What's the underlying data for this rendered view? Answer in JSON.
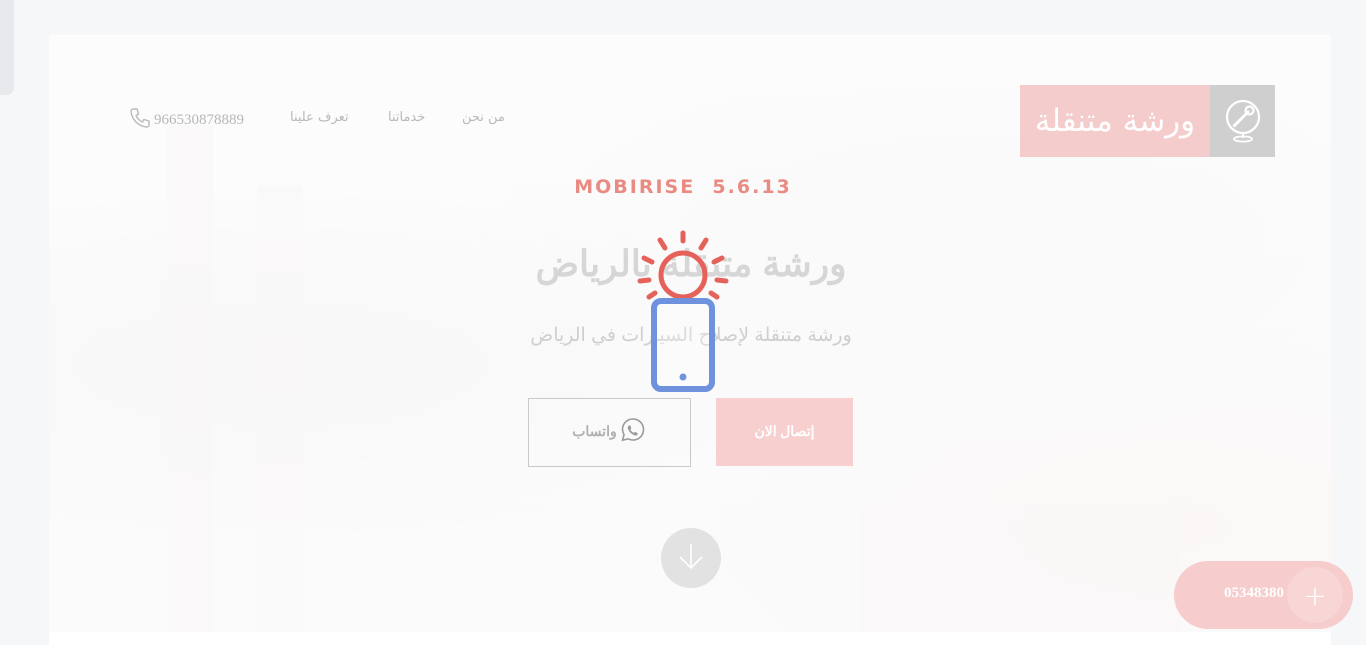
{
  "nav": {
    "logo_text": "ورشة متنقلة",
    "items": [
      "من نحن",
      "خدماتنا",
      "تعرف علينا"
    ],
    "phone": "966530878889"
  },
  "hero": {
    "brand": "MOBIRISE  5.6.13",
    "title": "ورشة متنقلة بالرياض",
    "subtitle": "ورشة متنقلة لإصلاح السيارات في الرياض",
    "call_button": "إتصال الان",
    "whatsapp_button": "واتساب"
  },
  "fab": {
    "number": "05348380",
    "plus": "+"
  },
  "colors": {
    "accent": "#e98b83",
    "button_pink": "#f7cfcf",
    "loader_red": "#e5625a",
    "loader_blue": "#6f92de"
  },
  "icons": {
    "logo": "wrench-location-icon",
    "phone": "phone-icon",
    "whatsapp": "whatsapp-icon",
    "scroll": "arrow-down-icon",
    "loader": "ringing-mobile-icon"
  }
}
